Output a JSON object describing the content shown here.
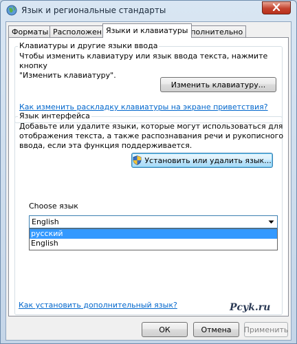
{
  "window": {
    "title": "Язык и региональные стандарты"
  },
  "tabs": [
    {
      "label": "Форматы",
      "active": false
    },
    {
      "label": "Расположение",
      "active": false
    },
    {
      "label": "Языки и клавиатуры",
      "active": true
    },
    {
      "label": "Дополнительно",
      "active": false
    }
  ],
  "keyboards_group": {
    "label": "Клавиатуры и другие языки ввода",
    "description_line1": "Чтобы изменить клавиатуру или язык ввода текста, нажмите кнопку",
    "description_line2": "\"Изменить клавиатуру\".",
    "change_button": "Изменить клавиатуру...",
    "link": "Как изменить раскладку клавиатуры на экране приветствия?"
  },
  "display_language_group": {
    "label": "Язык интерфейса",
    "description_line1": "Добавьте или удалите языки, которые могут использоваться для",
    "description_line2": "отображения текста, а также распознавания речи и рукописного",
    "description_line3": "ввода, если эта функция поддерживается.",
    "install_button": "Установить или удалить язык...",
    "choose_label": "Choose  язык",
    "selected_value": "English",
    "options": [
      "русский",
      "English"
    ]
  },
  "footer": {
    "link": "Как установить дополнительный язык?",
    "watermark": "Pcyk.ru",
    "ok": "ОК",
    "cancel": "Отмена",
    "apply": "Применить"
  }
}
